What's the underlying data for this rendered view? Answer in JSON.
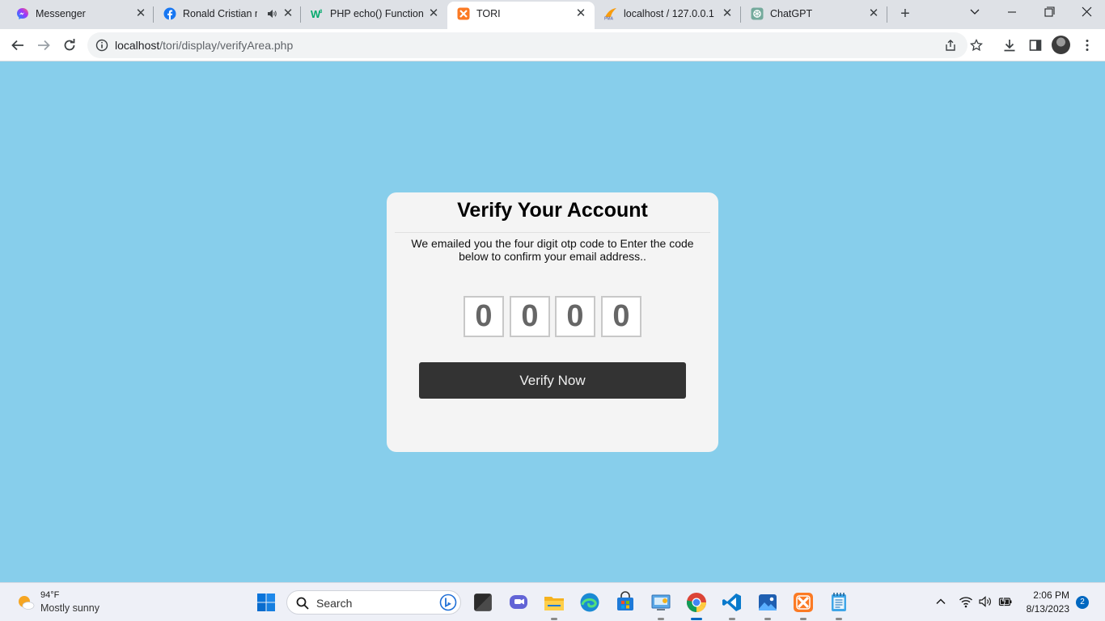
{
  "browser": {
    "tabs": [
      {
        "title": "Messenger",
        "icon": "messenger-icon"
      },
      {
        "title": "Ronald Cristian m",
        "icon": "facebook-icon",
        "muted_icon": "speaker-icon"
      },
      {
        "title": "PHP echo() Function",
        "icon": "w3schools-icon"
      },
      {
        "title": "TORI",
        "icon": "xampp-icon",
        "active": true
      },
      {
        "title": "localhost / 127.0.0.1 /",
        "icon": "phpmyadmin-icon"
      },
      {
        "title": "ChatGPT",
        "icon": "chatgpt-icon"
      }
    ],
    "close_glyph": "✕",
    "new_tab_glyph": "+",
    "url_host": "localhost",
    "url_path": "/tori/display/verifyArea.php"
  },
  "page": {
    "heading": "Verify Your Account",
    "description": "We emailed you the four digit otp code to Enter the code below to confirm your email address..",
    "otp_digits": [
      "0",
      "0",
      "0",
      "0"
    ],
    "button_label": "Verify Now",
    "background_color": "#87ceeb",
    "card_color": "#f4f4f4",
    "button_color": "#333333"
  },
  "taskbar": {
    "weather_temp": "94°F",
    "weather_condition": "Mostly sunny",
    "search_placeholder": "Search",
    "time": "2:06 PM",
    "date": "8/13/2023",
    "notification_count": "2"
  }
}
